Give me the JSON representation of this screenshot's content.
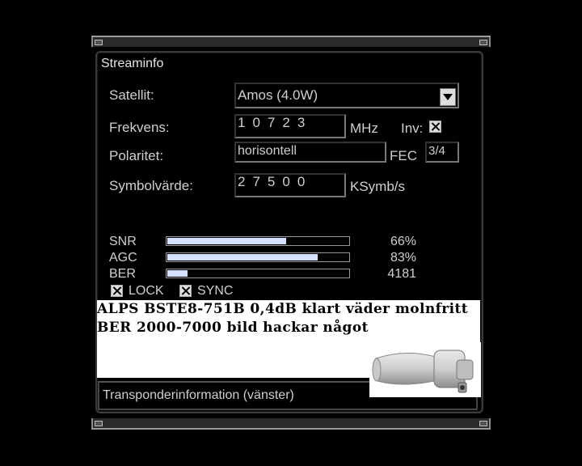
{
  "window": {
    "title": "Streaminfo"
  },
  "satellite": {
    "label": "Satellit:",
    "value": "Amos (4.0W)"
  },
  "frequency": {
    "label": "Frekvens:",
    "value": "10723",
    "unit": "MHz",
    "inv_label": "Inv:",
    "inv_checked": true
  },
  "polarity": {
    "label": "Polaritet:",
    "value": "horisontell",
    "fec_label": "FEC",
    "fec_value": "3/4"
  },
  "symbolrate": {
    "label": "Symbolvärde:",
    "value": "27500",
    "unit": "KSymb/s"
  },
  "signal": [
    {
      "label": "SNR",
      "value": "66%",
      "level": 0.66
    },
    {
      "label": "AGC",
      "value": "83%",
      "level": 0.83
    },
    {
      "label": "BER",
      "value": "4181",
      "level": 0.12
    }
  ],
  "status": {
    "lock_label": "LOCK",
    "sync_label": "SYNC",
    "lock_checked": true,
    "sync_checked": true
  },
  "note": {
    "line1": "ALPS BSTE8-751B 0,4dB klart väder molnfritt",
    "line2": "BER 2000-7000 bild hackar något"
  },
  "footer": {
    "label": "Transponderinformation (vänster)"
  },
  "colors": {
    "bar_fill": "#d6e0ff",
    "background": "#000000",
    "text": "#cfcfcf"
  }
}
